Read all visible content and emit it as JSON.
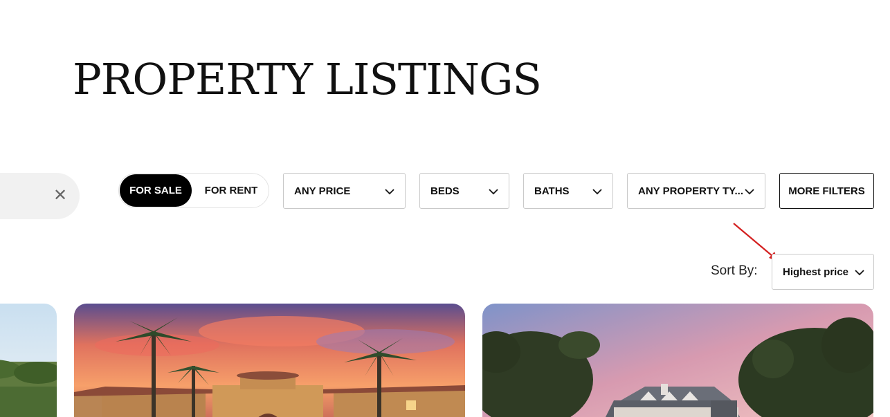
{
  "header": {
    "title": "PROPERTY LISTINGS"
  },
  "search": {
    "clear_icon": "close-icon",
    "clear_glyph": "✕"
  },
  "listing_type": {
    "options": [
      "FOR SALE",
      "FOR RENT"
    ],
    "selected": "FOR SALE"
  },
  "filters": {
    "price": "ANY PRICE",
    "beds": "BEDS",
    "baths": "BATHS",
    "property_type": "ANY PROPERTY TY...",
    "more": "MORE FILTERS"
  },
  "sort": {
    "label": "Sort By:",
    "value": "Highest price"
  },
  "annotation": {
    "arrow_color": "#d42020"
  },
  "colors": {
    "accent": "#000000",
    "border": "#c9c9c9"
  }
}
